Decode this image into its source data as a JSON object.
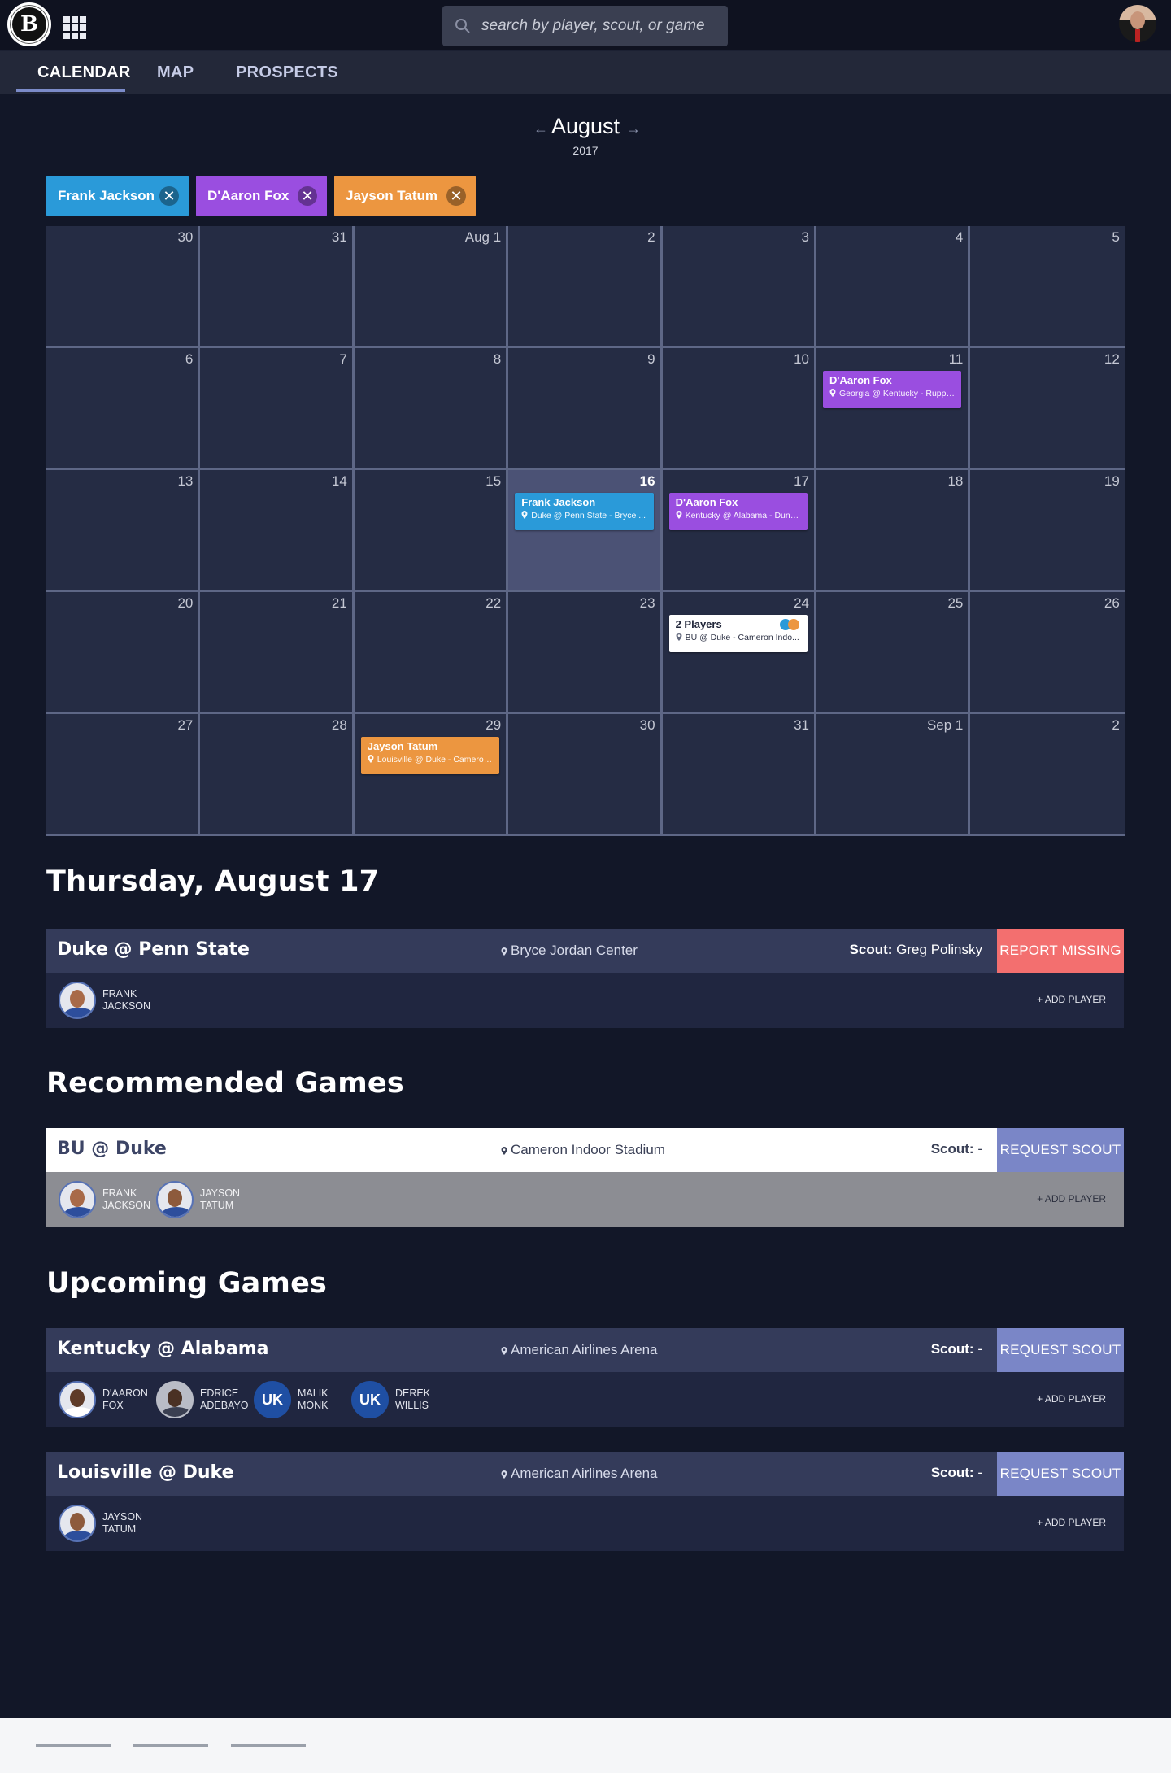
{
  "header": {
    "logo_label": "B",
    "search_placeholder": "search by player, scout, or game"
  },
  "tabs": [
    {
      "label": "CALENDAR",
      "active": true
    },
    {
      "label": "MAP",
      "active": false
    },
    {
      "label": "PROSPECTS",
      "active": false
    }
  ],
  "calendar": {
    "month": "August",
    "year": "2017",
    "prev_arrow": "←",
    "next_arrow": "→",
    "filters": [
      {
        "name": "Frank Jackson",
        "color": "#2a9ad9",
        "remove": "✕"
      },
      {
        "name": "D'Aaron Fox",
        "color": "#9a4ee0",
        "remove": "✕"
      },
      {
        "name": "Jayson Tatum",
        "color": "#ec9640",
        "remove": "✕"
      }
    ],
    "weeks": [
      [
        "30",
        "31",
        "Aug 1",
        "2",
        "3",
        "4",
        "5"
      ],
      [
        "6",
        "7",
        "8",
        "9",
        "10",
        "11",
        "12"
      ],
      [
        "13",
        "14",
        "15",
        "16",
        "17",
        "18",
        "19"
      ],
      [
        "20",
        "21",
        "22",
        "23",
        "24",
        "25",
        "26"
      ],
      [
        "27",
        "28",
        "29",
        "30",
        "31",
        "Sep 1",
        "2"
      ]
    ],
    "today": "16",
    "events": {
      "d11": {
        "name": "D'Aaron Fox",
        "loc": "Georgia @ Kentucky - Rupp ..."
      },
      "d16": {
        "name": "Frank Jackson",
        "loc": "Duke @ Penn State - Bryce ..."
      },
      "d17": {
        "name": "D'Aaron Fox",
        "loc": "Kentucky @ Alabama - Dunn..."
      },
      "d24": {
        "name": "2 Players",
        "loc": "BU @ Duke - Cameron Indo..."
      },
      "d29": {
        "name": "Jayson Tatum",
        "loc": "Louisville @ Duke - Cameron..."
      }
    }
  },
  "selected_day": {
    "heading": "Thursday, August 17",
    "game": {
      "title": "Duke @ Penn State",
      "venue": "Bryce Jordan Center",
      "scout_label": "Scout:",
      "scout_name": "Greg Polinsky",
      "button": "REPORT MISSING",
      "players": [
        {
          "first": "FRANK",
          "last": "JACKSON"
        }
      ],
      "add_player": "+ ADD PLAYER"
    }
  },
  "recommended": {
    "heading": "Recommended Games",
    "game": {
      "title": "BU @ Duke",
      "venue": "Cameron Indoor Stadium",
      "scout_label": "Scout:",
      "scout_name": "-",
      "button": "REQUEST SCOUT",
      "players": [
        {
          "first": "FRANK",
          "last": "JACKSON"
        },
        {
          "first": "JAYSON",
          "last": "TATUM"
        }
      ],
      "add_player": "+ ADD PLAYER"
    }
  },
  "upcoming": {
    "heading": "Upcoming Games",
    "games": [
      {
        "title": "Kentucky @ Alabama",
        "venue": "American Airlines Arena",
        "scout_label": "Scout:",
        "scout_name": "-",
        "button": "REQUEST SCOUT",
        "players": [
          {
            "first": "D'AARON",
            "last": "FOX"
          },
          {
            "first": "EDRICE",
            "last": "ADEBAYO"
          },
          {
            "first": "MALIK",
            "last": "MONK",
            "uk": "UK"
          },
          {
            "first": "DEREK",
            "last": "WILLIS",
            "uk": "UK"
          }
        ],
        "add_player": "+ ADD PLAYER"
      },
      {
        "title": "Louisville @ Duke",
        "venue": "American Airlines Arena",
        "scout_label": "Scout:",
        "scout_name": "-",
        "button": "REQUEST SCOUT",
        "players": [
          {
            "first": "JAYSON",
            "last": "TATUM"
          }
        ],
        "add_player": "+ ADD PLAYER"
      }
    ]
  },
  "colors": {
    "background": "#121728",
    "cell": "#252c44",
    "today_cell": "#4b5275",
    "accent": "#7a86c7",
    "report_missing": "#f36f6f"
  }
}
